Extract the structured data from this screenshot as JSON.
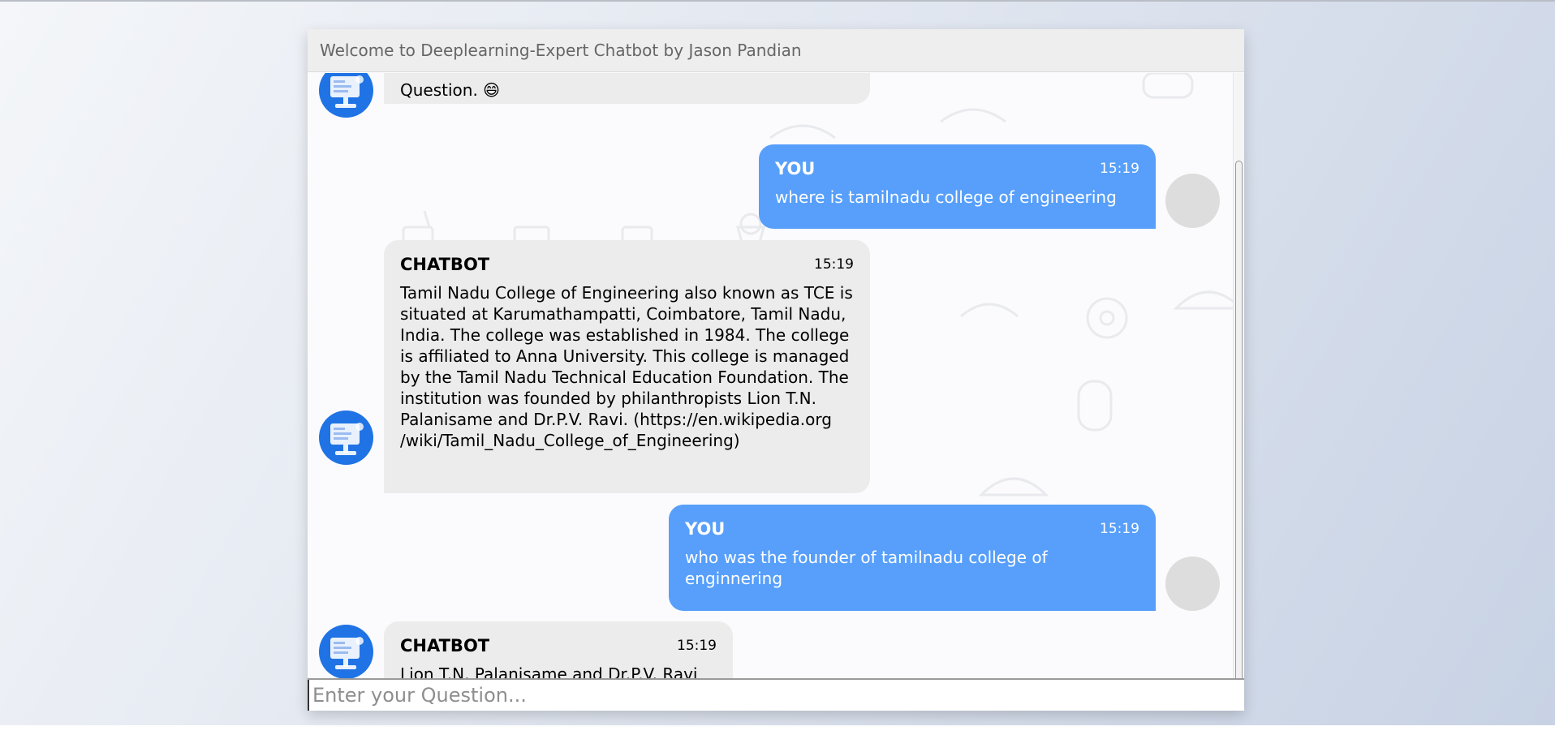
{
  "header": {
    "title": "Welcome to Deeplearning-Expert Chatbot by Jason Pandian"
  },
  "messages": [
    {
      "sender": "bot",
      "text": "Question. 😄"
    },
    {
      "sender": "user",
      "name": "YOU",
      "time": "15:19",
      "text": "where is tamilnadu college of engineering"
    },
    {
      "sender": "bot",
      "name": "CHATBOT",
      "time": "15:19",
      "text": "Tamil Nadu College of Engineering also known as TCE is situated at Karumathampatti, Coimbatore, Tamil Nadu, India. The college was established in 1984. The college is affiliated to Anna University. This college is managed by the Tamil Nadu Technical Education Foundation. The institution was founded by philanthropists Lion T.N. Palanisame and Dr.P.V. Ravi. (https://en.wikipedia.org /wiki/Tamil_Nadu_College_of_Engineering)"
    },
    {
      "sender": "user",
      "name": "YOU",
      "time": "15:19",
      "text": "who was the founder of tamilnadu college of enginnering"
    },
    {
      "sender": "bot",
      "name": "CHATBOT",
      "time": "15:19",
      "text": "Lion T.N. Palanisame and Dr.P.V. Ravi"
    }
  ],
  "input": {
    "placeholder": "Enter your Question..."
  },
  "colors": {
    "user_bubble": "#579ffb",
    "bot_bubble": "#ececec",
    "bot_avatar": "#1f73e4"
  }
}
